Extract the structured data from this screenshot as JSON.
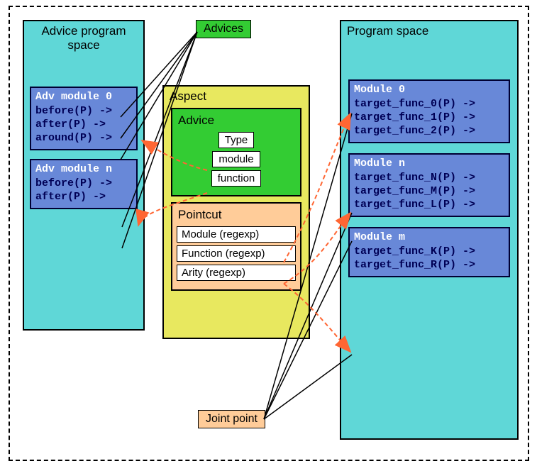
{
  "labels": {
    "advices": "Advices",
    "aspect": "Aspect",
    "advice": "Advice",
    "pointcut": "Pointcut",
    "joint": "Joint point"
  },
  "adviceSpace": {
    "title": "Advice program space",
    "mods": [
      {
        "t": "Adv module 0",
        "l": [
          "before(P) ->",
          "after(P) ->",
          "around(P) ->"
        ]
      },
      {
        "t": "Adv module n",
        "l": [
          "before(P) ->",
          "after(P) ->"
        ]
      }
    ]
  },
  "programSpace": {
    "title": "Program space",
    "mods": [
      {
        "t": "Module 0",
        "l": [
          "target_func_0(P) ->",
          "target_func_1(P) ->",
          "target_func_2(P) ->"
        ]
      },
      {
        "t": "Module n",
        "l": [
          "target_func_N(P) ->",
          "target_func_M(P) ->",
          "target_func_L(P) ->"
        ]
      },
      {
        "t": "Module m",
        "l": [
          "target_func_K(P) ->",
          "target_func_R(P) ->"
        ]
      }
    ]
  },
  "adviceBox": [
    "Type",
    "module",
    "function"
  ],
  "pointcutBox": [
    "Module (regexp)",
    "Function (regexp)",
    "Arity (regexp)"
  ]
}
